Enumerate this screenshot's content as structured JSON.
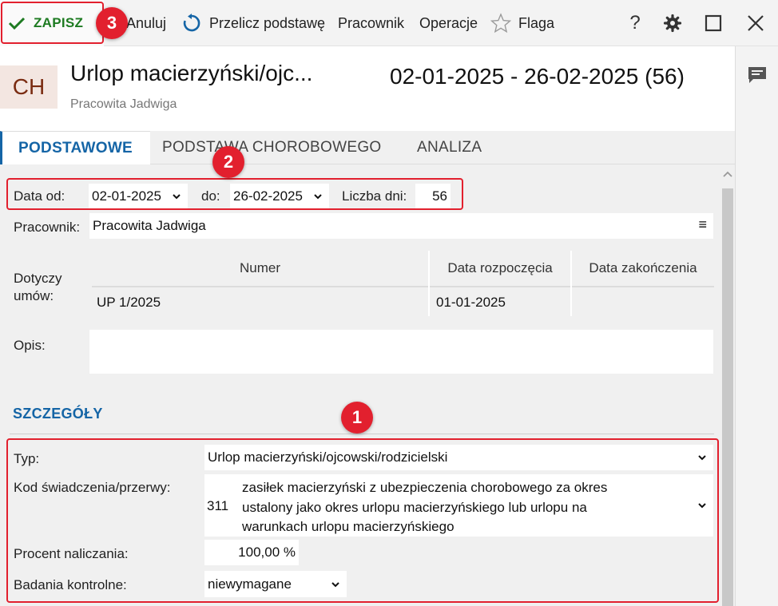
{
  "toolbar": {
    "save": "ZAPISZ",
    "cancel": "Anuluj",
    "recalculate": "Przelicz podstawę",
    "employee": "Pracownik",
    "operations": "Operacje",
    "flag": "Flaga",
    "help": "?"
  },
  "header": {
    "avatar": "CH",
    "title": "Urlop macierzyński/ojc...",
    "subtitle": "Pracowita Jadwiga",
    "period": "02-01-2025 - 26-02-2025 (56)"
  },
  "tabs": [
    {
      "label": "PODSTAWOWE",
      "active": true
    },
    {
      "label": "PODSTAWA CHOROBOWEGO",
      "active": false
    },
    {
      "label": "ANALIZA",
      "active": false
    }
  ],
  "form": {
    "date_from_label": "Data od:",
    "date_from": "02-01-2025",
    "date_to_label": "do:",
    "date_to": "26-02-2025",
    "days_label": "Liczba dni:",
    "days": "56",
    "employee_label": "Pracownik:",
    "employee": "Pracowita Jadwiga",
    "menu_glyph": "≡",
    "contracts_label": "Dotyczy umów:",
    "contracts_columns": [
      "Numer",
      "Data rozpoczęcia",
      "Data zakończenia"
    ],
    "contracts_rows": [
      {
        "number": "UP 1/2025",
        "start": "01-01-2025",
        "end": ""
      }
    ],
    "description_label": "Opis:",
    "description": ""
  },
  "details": {
    "section_title": "SZCZEGÓŁY",
    "type_label": "Typ:",
    "type": "Urlop macierzyński/ojcowski/rodzicielski",
    "code_label": "Kod świadczenia/przerwy:",
    "code": "311",
    "code_desc_lines": [
      "zasiłek macierzyński z ubezpieczenia chorobowego za okres",
      "ustalony jako okres urlopu macierzyńskiego lub urlopu na",
      "warunkach urlopu macierzyńskiego"
    ],
    "percent_label": "Procent naliczania:",
    "percent": "100,00 %",
    "control_label": "Badania kontrolne:",
    "control": "niewymagane"
  },
  "annotations": [
    "1",
    "2",
    "3"
  ],
  "colors": {
    "accent_blue": "#1565a6",
    "save_green": "#1e7b22",
    "annotation_red": "#e2202e",
    "avatar_bg": "#f3e6e1",
    "avatar_text": "#7a2c12"
  },
  "icons": {
    "save": "check-icon",
    "recalculate": "refresh-icon",
    "flag": "star-outline-icon",
    "help": "question-icon",
    "settings": "gear-icon",
    "maximize": "square-icon",
    "close": "close-icon",
    "comments": "comment-icon"
  }
}
